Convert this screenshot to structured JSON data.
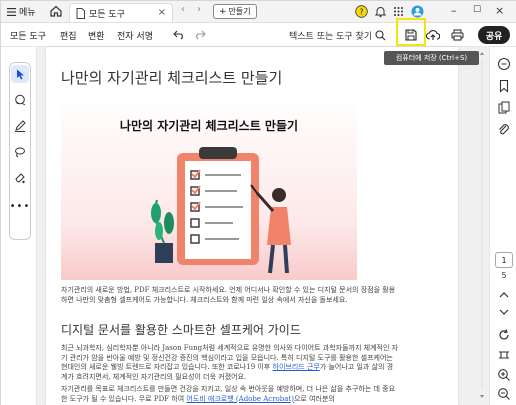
{
  "titlebar": {
    "menu_label": "메뉴",
    "tab_title": "모든 도구",
    "new_tab_label": "만들기"
  },
  "toolbar": {
    "menus": [
      "모든 도구",
      "편집",
      "변환",
      "전자 서명"
    ],
    "search_label": "텍스트 또는 도구 찾기",
    "share_label": "공유",
    "save_tooltip": "컴퓨터에 저장 (Ctrl+S)"
  },
  "document": {
    "title": "나만의 자기관리 체크리스트 만들기",
    "hero_title": "나만의 자기관리 체크리스트 만들기",
    "paragraph1": "자기관리의 새로운 방법, PDF 체크리스트로 시작하세요. 언제 어디서나 확인할 수 있는 디지털 문서의 장점을 활용하면 나만의 맞춤형 셀프케어도 가능합니다. 체크리스트와 함께 마련 일상 속에서 자신을 돌보세요.",
    "heading2": "디지털 문서를 활용한 스마트한 셀프케어 가이드",
    "paragraph2_a": "최근 뇌과학자, 심리학자뿐 아니라 Jason Fung처럼 세계적으로 유명한 의사와 다이어트 과학자들까지 체계적인 자기 관리가 암을 반아울 예방 및 정신건강 증진의 핵심이라고 입을 모읍니다. 특히 디지털 도구를 활용한 셀프케어는 현대인의 새로운 웰빙 트렌드로 자리잡고 있습니다. 또한 코로나19 이후",
    "paragraph2_link": "하이브리드 근무",
    "paragraph2_b": "가 늘어나고 일과 삶의 경계가 흐려지면서, 체계적인 자기관리의 필요성이 더욱 커졌어요.",
    "paragraph3_a": "자기관리를 목표로 체크리스트를 만들면 건강을 지키고, 일상 속 번아웃을 예방하며, 더 나은 삶을 추구하는 데 중요한 도구가 될 수 있습니다. 무료 PDF 하여",
    "paragraph3_link": "어도비 애크로뱃 (Adobe Acrobat)",
    "paragraph3_b": "으로 여러분의"
  },
  "pagination": {
    "current": "1",
    "total": "5"
  },
  "colors": {
    "highlight": "#f5e60a",
    "accent_blue": "#2a5bd7",
    "hero_pink": "#f9caca",
    "clipboard_orange": "#f0836a"
  }
}
